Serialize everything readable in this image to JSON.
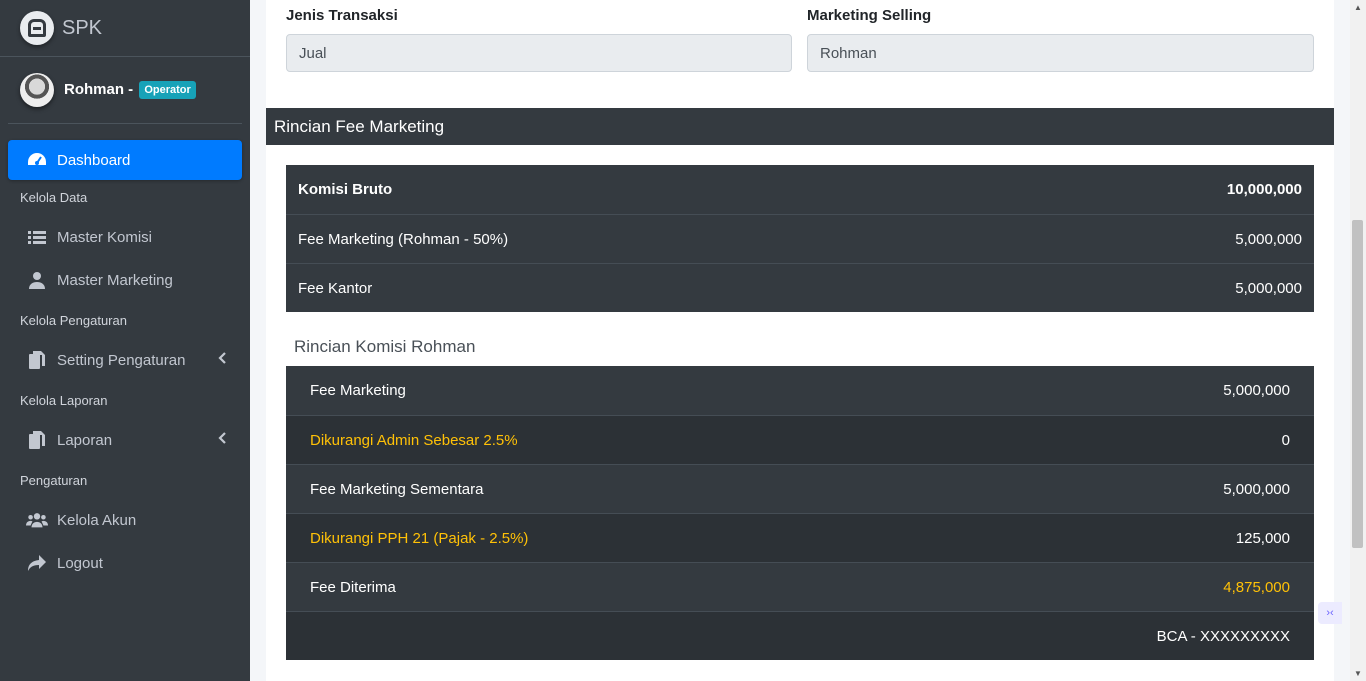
{
  "brand": {
    "name": "SPK",
    "icon": "brand-logo-icon"
  },
  "user": {
    "name": "Rohman -",
    "role_badge": "Operator"
  },
  "sidebar": {
    "items": [
      {
        "type": "link",
        "label": "Dashboard",
        "icon": "dashboard-icon",
        "active": true
      },
      {
        "type": "header",
        "label": "Kelola Data"
      },
      {
        "type": "link",
        "label": "Master Komisi",
        "icon": "list-icon"
      },
      {
        "type": "link",
        "label": "Master Marketing",
        "icon": "user-icon"
      },
      {
        "type": "header",
        "label": "Kelola Pengaturan"
      },
      {
        "type": "link",
        "label": "Setting Pengaturan",
        "icon": "copy-icon",
        "chevron": true
      },
      {
        "type": "header",
        "label": "Kelola Laporan"
      },
      {
        "type": "link",
        "label": "Laporan",
        "icon": "copy-icon",
        "chevron": true
      },
      {
        "type": "header",
        "label": "Pengaturan"
      },
      {
        "type": "link",
        "label": "Kelola Akun",
        "icon": "users-icon"
      },
      {
        "type": "link",
        "label": "Logout",
        "icon": "share-icon"
      }
    ]
  },
  "form": {
    "jenis_label": "Jenis Transaksi",
    "jenis_value": "Jual",
    "marketing_label": "Marketing Selling",
    "marketing_value": "Rohman"
  },
  "section": {
    "title": "Rincian Fee Marketing"
  },
  "fee_table": {
    "rows": [
      {
        "label": "Komisi Bruto",
        "value": "10,000,000",
        "bold": true
      },
      {
        "label": "Fee Marketing (Rohman - 50%)",
        "value": "5,000,000"
      },
      {
        "label": "Fee Kantor",
        "value": "5,000,000"
      }
    ]
  },
  "komisi": {
    "title": "Rincian Komisi Rohman",
    "rows": [
      {
        "label": "Fee Marketing",
        "value": "5,000,000"
      },
      {
        "label": "Dikurangi Admin Sebesar 2.5%",
        "value": "0",
        "warn_label": true
      },
      {
        "label": "Fee Marketing Sementara",
        "value": "5,000,000"
      },
      {
        "label": "Dikurangi PPH 21 (Pajak - 2.5%)",
        "value": "125,000",
        "warn_label": true
      },
      {
        "label": "Fee Diterima",
        "value": "4,875,000",
        "warn_value": true
      },
      {
        "label": "",
        "value": "BCA - XXXXXXXXX"
      }
    ]
  },
  "colors": {
    "sidebar": "#343a40",
    "active": "#007bff",
    "badge": "#17a2b8",
    "warning": "#ffc107"
  },
  "float_button": {
    "label": "›‹"
  }
}
